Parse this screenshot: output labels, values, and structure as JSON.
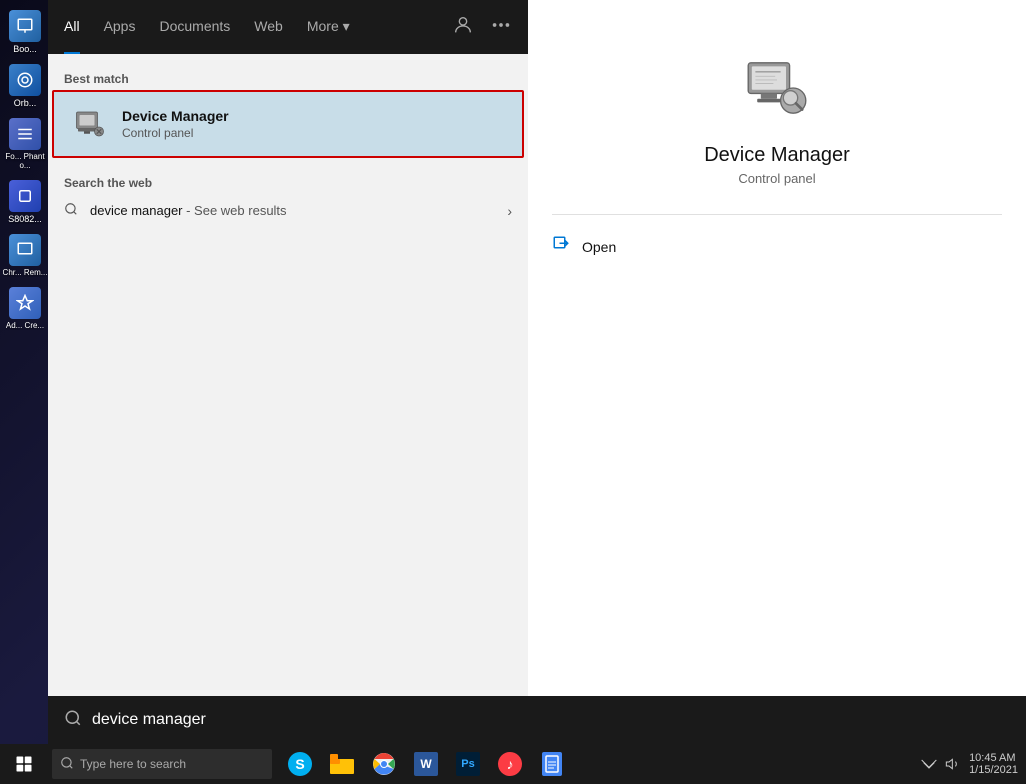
{
  "desktop": {
    "background": "#1a1a2e"
  },
  "taskbar": {
    "start_label": "Start",
    "search_placeholder": "Type here to search",
    "apps": [
      "Skype",
      "File Explorer",
      "Chrome",
      "Word",
      "Photoshop",
      "iTunes",
      "Docs"
    ]
  },
  "search_nav": {
    "tabs": [
      {
        "label": "All",
        "active": true
      },
      {
        "label": "Apps",
        "active": false
      },
      {
        "label": "Documents",
        "active": false
      },
      {
        "label": "Web",
        "active": false
      },
      {
        "label": "More ▾",
        "active": false
      }
    ]
  },
  "search_results": {
    "best_match_label": "Best match",
    "best_match": {
      "title": "Device Manager",
      "subtitle": "Control panel"
    },
    "web_search_label": "Search the web",
    "web_results": [
      {
        "query": "device manager",
        "suffix": " - See web results"
      }
    ]
  },
  "result_detail": {
    "title": "Device Manager",
    "subtitle": "Control panel",
    "actions": [
      {
        "label": "Open",
        "icon": "open-external-icon"
      }
    ]
  },
  "search_bar": {
    "query": "device manager",
    "placeholder": "Type here to search"
  },
  "desktop_icons": [
    {
      "label": "Boo...",
      "color": "#4a90d9"
    },
    {
      "label": "Orb...",
      "color": "#3a80c9"
    },
    {
      "label": "Fo... Phanto...",
      "color": "#5a70c9"
    },
    {
      "label": "S8082...",
      "color": "#4a60d9"
    },
    {
      "label": "Chr... Rem...",
      "color": "#4a90d9"
    },
    {
      "label": "Ad... Cre...",
      "color": "#5a80d9"
    }
  ]
}
